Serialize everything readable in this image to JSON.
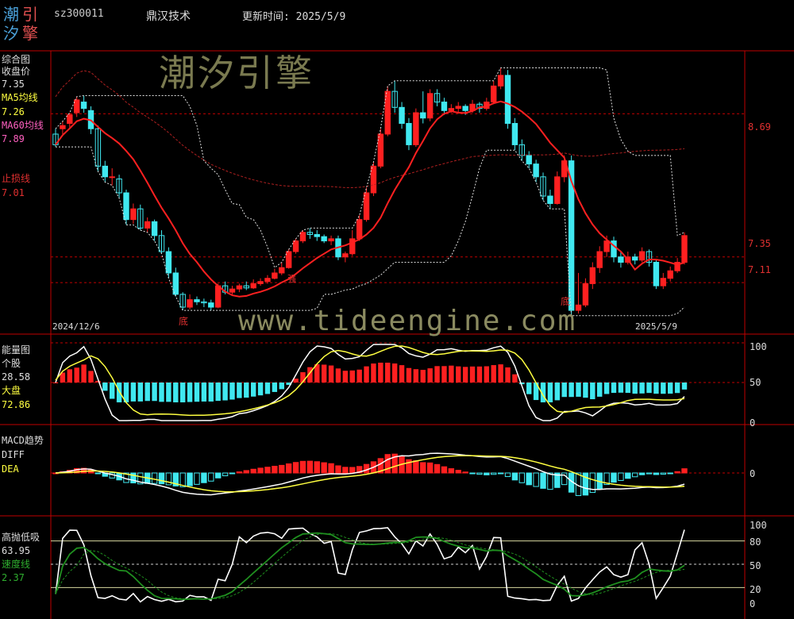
{
  "header": {
    "logo_chars": [
      "潮",
      "引",
      "汐",
      "擎"
    ],
    "code": "sz300011",
    "name": "鼎汉技术",
    "update_label": "更新时间: 2025/5/9"
  },
  "colors": {
    "up": "#ff2020",
    "down": "#40e8f0",
    "yellow": "#ffff40",
    "pink": "#ff60c0",
    "green": "#1f8f1f",
    "axis": "#c00000"
  },
  "main_panel": {
    "title": "综合图",
    "close_label": "收盘价",
    "close_value": "7.35",
    "ma5_label": "MA5均线",
    "ma5_value": "7.26",
    "ma60_label": "MA60均线",
    "ma60_value": "7.89",
    "stop_label": "止损线",
    "stop_value": "7.01",
    "watermark_cn": "潮汐引擎",
    "watermark_url": "www.tideengine.com",
    "date_start": "2024/12/6",
    "date_end": "2025/5/9",
    "ticks": [
      "8.69",
      "7.35",
      "7.11"
    ],
    "marker_di_1": "底",
    "marker_qiang": "强",
    "marker_di_2": "底"
  },
  "energy_panel": {
    "title": "能量图",
    "stock_label": "个股",
    "stock_value": "28.58",
    "market_label": "大盘",
    "market_value": "72.86",
    "ticks": [
      "100",
      "50",
      "0"
    ]
  },
  "macd_panel": {
    "title": "MACD趋势",
    "diff_label": "DIFF",
    "dea_label": "DEA",
    "ticks": [
      "0"
    ]
  },
  "gaoxi_panel": {
    "title": "高抛低吸",
    "value": "63.95",
    "speed_label": "速度线",
    "speed_value": "2.37",
    "ticks": [
      "100",
      "80",
      "50",
      "20",
      "0"
    ]
  },
  "chart_data": {
    "type": "candlestick",
    "date_range": [
      "2024/12/6",
      "2025/5/9"
    ],
    "ohlc": [
      [
        8.5,
        8.4,
        8.55,
        8.38
      ],
      [
        8.55,
        8.58,
        8.62,
        8.5
      ],
      [
        8.6,
        8.68,
        8.7,
        8.56
      ],
      [
        8.7,
        8.82,
        8.85,
        8.66
      ],
      [
        8.8,
        8.74,
        8.86,
        8.7
      ],
      [
        8.72,
        8.55,
        8.76,
        8.5
      ],
      [
        8.55,
        8.2,
        8.58,
        8.15
      ],
      [
        8.2,
        8.1,
        8.25,
        8.05
      ],
      [
        8.1,
        8.1,
        8.18,
        8.02
      ],
      [
        8.08,
        7.95,
        8.12,
        7.9
      ],
      [
        7.95,
        7.7,
        7.98,
        7.65
      ],
      [
        7.7,
        7.8,
        7.85,
        7.66
      ],
      [
        7.8,
        7.62,
        7.84,
        7.6
      ],
      [
        7.62,
        7.68,
        7.72,
        7.58
      ],
      [
        7.68,
        7.55,
        7.7,
        7.5
      ],
      [
        7.55,
        7.4,
        7.6,
        7.38
      ],
      [
        7.4,
        7.2,
        7.44,
        7.15
      ],
      [
        7.2,
        7.0,
        7.25,
        6.98
      ],
      [
        7.0,
        6.88,
        7.02,
        6.85
      ],
      [
        6.88,
        6.95,
        7.0,
        6.86
      ],
      [
        6.95,
        6.93,
        6.98,
        6.9
      ],
      [
        6.93,
        6.92,
        6.96,
        6.88
      ],
      [
        6.92,
        6.88,
        6.95,
        6.85
      ],
      [
        6.88,
        7.08,
        7.1,
        6.87
      ],
      [
        7.08,
        7.02,
        7.12,
        7.0
      ],
      [
        7.02,
        7.05,
        7.08,
        7.0
      ],
      [
        7.05,
        7.08,
        7.1,
        7.02
      ],
      [
        7.08,
        7.06,
        7.12,
        7.04
      ],
      [
        7.06,
        7.1,
        7.14,
        7.05
      ],
      [
        7.1,
        7.12,
        7.15,
        7.08
      ],
      [
        7.12,
        7.15,
        7.18,
        7.1
      ],
      [
        7.15,
        7.2,
        7.24,
        7.14
      ],
      [
        7.2,
        7.25,
        7.3,
        7.18
      ],
      [
        7.25,
        7.4,
        7.42,
        7.24
      ],
      [
        7.4,
        7.5,
        7.52,
        7.38
      ],
      [
        7.5,
        7.58,
        7.6,
        7.48
      ],
      [
        7.58,
        7.56,
        7.62,
        7.52
      ],
      [
        7.56,
        7.54,
        7.6,
        7.5
      ],
      [
        7.54,
        7.5,
        7.56,
        7.48
      ],
      [
        7.5,
        7.52,
        7.55,
        7.46
      ],
      [
        7.52,
        7.35,
        7.55,
        7.32
      ],
      [
        7.35,
        7.38,
        7.4,
        7.3
      ],
      [
        7.38,
        7.52,
        7.6,
        7.36
      ],
      [
        7.52,
        7.7,
        7.74,
        7.5
      ],
      [
        7.7,
        7.95,
        8.0,
        7.68
      ],
      [
        7.95,
        8.2,
        8.24,
        7.92
      ],
      [
        8.2,
        8.5,
        8.55,
        8.18
      ],
      [
        8.5,
        8.9,
        8.95,
        8.48
      ],
      [
        8.9,
        8.75,
        9.0,
        8.7
      ],
      [
        8.75,
        8.6,
        8.8,
        8.55
      ],
      [
        8.6,
        8.4,
        8.65,
        8.35
      ],
      [
        8.4,
        8.7,
        8.74,
        8.38
      ],
      [
        8.7,
        8.65,
        8.9,
        8.6
      ],
      [
        8.65,
        8.88,
        8.92,
        8.62
      ],
      [
        8.88,
        8.8,
        8.92,
        8.76
      ],
      [
        8.8,
        8.72,
        8.84,
        8.68
      ],
      [
        8.72,
        8.74,
        8.78,
        8.7
      ],
      [
        8.74,
        8.76,
        8.8,
        8.7
      ],
      [
        8.76,
        8.72,
        8.78,
        8.68
      ],
      [
        8.72,
        8.78,
        8.82,
        8.7
      ],
      [
        8.78,
        8.74,
        8.8,
        8.7
      ],
      [
        8.74,
        8.8,
        8.84,
        8.72
      ],
      [
        8.8,
        8.95,
        9.0,
        8.78
      ],
      [
        8.95,
        9.05,
        9.12,
        8.92
      ],
      [
        9.05,
        8.6,
        9.1,
        8.55
      ],
      [
        8.6,
        8.4,
        8.65,
        8.35
      ],
      [
        8.4,
        8.3,
        8.45,
        8.25
      ],
      [
        8.3,
        8.22,
        8.34,
        8.18
      ],
      [
        8.22,
        8.1,
        8.26,
        8.05
      ],
      [
        8.1,
        7.92,
        8.14,
        7.88
      ],
      [
        7.92,
        7.85,
        7.98,
        7.8
      ],
      [
        7.85,
        8.1,
        8.15,
        7.84
      ],
      [
        8.1,
        8.25,
        8.3,
        8.05
      ],
      [
        8.25,
        6.85,
        8.3,
        6.8
      ],
      [
        6.85,
        6.9,
        7.2,
        6.82
      ],
      [
        6.9,
        7.1,
        7.15,
        6.88
      ],
      [
        7.1,
        7.25,
        7.3,
        7.05
      ],
      [
        7.25,
        7.4,
        7.45,
        7.2
      ],
      [
        7.4,
        7.5,
        7.55,
        7.35
      ],
      [
        7.5,
        7.35,
        7.54,
        7.3
      ],
      [
        7.35,
        7.3,
        7.4,
        7.25
      ],
      [
        7.3,
        7.35,
        7.4,
        7.28
      ],
      [
        7.35,
        7.32,
        7.38,
        7.28
      ],
      [
        7.32,
        7.4,
        7.44,
        7.3
      ],
      [
        7.4,
        7.3,
        7.42,
        7.26
      ],
      [
        7.3,
        7.08,
        7.32,
        7.05
      ],
      [
        7.08,
        7.15,
        7.2,
        7.05
      ],
      [
        7.15,
        7.22,
        7.26,
        7.12
      ],
      [
        7.22,
        7.3,
        7.34,
        7.2
      ],
      [
        7.3,
        7.55,
        7.58,
        7.28
      ]
    ],
    "y_ticks": [
      8.69,
      7.35,
      7.11
    ]
  }
}
